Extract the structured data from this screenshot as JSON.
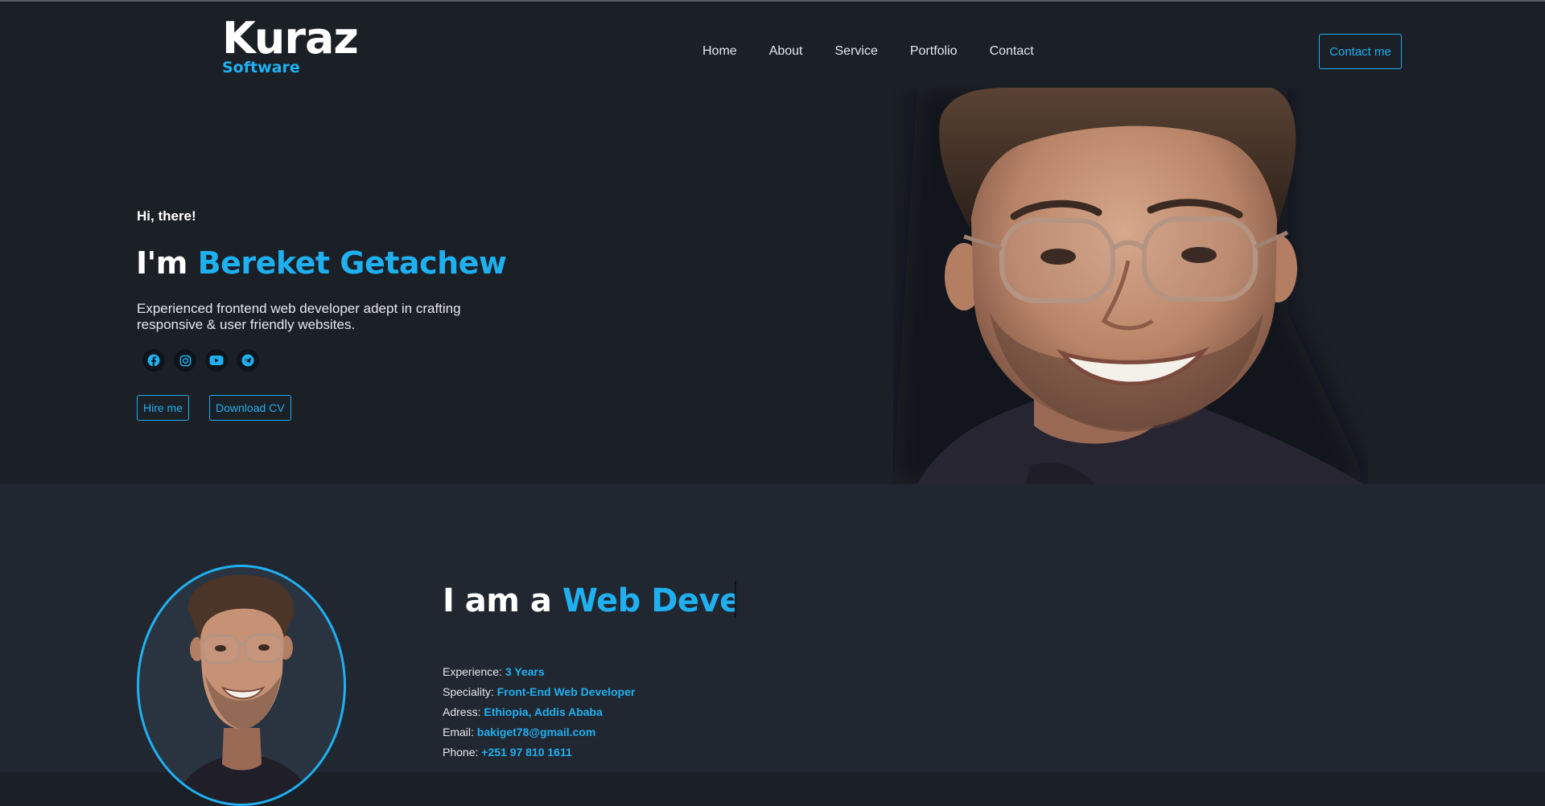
{
  "brand": {
    "name": "Kuraz",
    "sub": "Software"
  },
  "nav": {
    "items": [
      "Home",
      "About",
      "Service",
      "Portfolio",
      "Contact"
    ],
    "cta": "Contact me"
  },
  "hero": {
    "greeting": "Hi, there!",
    "prefix": "I'm",
    "name": "Bereket Getachew",
    "description": "Experienced frontend web developer adept in crafting responsive & user friendly websites.",
    "socials": [
      "facebook-icon",
      "instagram-icon",
      "youtube-icon",
      "telegram-icon"
    ],
    "buttons": {
      "hire": "Hire me",
      "cv": "Download CV"
    }
  },
  "about": {
    "title_prefix": "I am a",
    "title_typed": "Web Develo",
    "details": [
      {
        "label": "Experience:",
        "value": "3 Years"
      },
      {
        "label": "Speciality:",
        "value": "Front-End Web Developer"
      },
      {
        "label": "Adress:",
        "value": "Ethiopia, Addis Ababa"
      },
      {
        "label": "Email:",
        "value": "bakiget78@gmail.com"
      },
      {
        "label": "Phone:",
        "value": "+251 97 810 1611"
      }
    ]
  },
  "colors": {
    "accent": "#1fb0f0",
    "bg_dark": "#1b1f26",
    "bg_section": "#212730"
  }
}
